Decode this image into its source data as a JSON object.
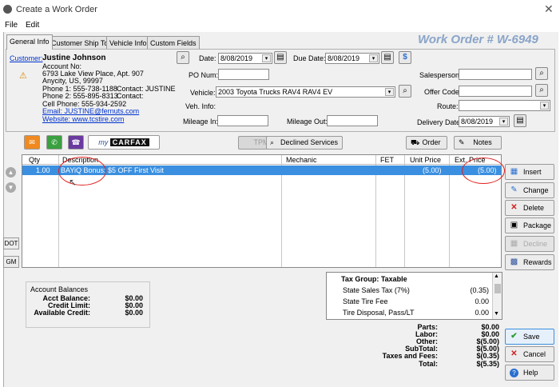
{
  "window": {
    "title": "Create a Work Order"
  },
  "menu": [
    "File",
    "Edit"
  ],
  "tabs": [
    "General Info",
    "Customer Ship To",
    "Vehicle Info",
    "Custom Fields"
  ],
  "work_order_title": "Work Order  # W-6949",
  "customer": {
    "label": "Customer:",
    "name": "Justine Johnson",
    "account": "Account No:",
    "address1": "6793 Lake View Place, Apt. 907",
    "address2": "Anycity, US, 99997",
    "phone1": "Phone 1: 555-738-1188",
    "contact1": "Contact: JUSTINE",
    "phone2": "Phone 2: 555-895-8313",
    "contact2": "Contact:",
    "cell": "Cell Phone: 555-934-2592",
    "email": "Email: JUSTINE@fernuts.com",
    "website": "Website: www.tcstire.com"
  },
  "fields": {
    "date_label": "Date:",
    "date": "8/08/2019",
    "due_label": "Due Date:",
    "due": "8/08/2019",
    "po_label": "PO Num:",
    "po": "",
    "vehicle_label": "Vehicle:",
    "vehicle": "2003 Toyota Trucks RAV4 RAV4 EV",
    "vehinfo_label": "Veh. Info:",
    "mileage_in_label": "Mileage In:",
    "mileage_in": "",
    "mileage_out_label": "Mileage Out:",
    "mileage_out": "",
    "salesperson_label": "Salesperson:",
    "salesperson": "",
    "offer_label": "Offer Code:",
    "offer": "",
    "route_label": "Route:",
    "route": "",
    "delivery_label": "Delivery Date:",
    "delivery": "8/08/2019"
  },
  "toolbar": {
    "carfax_my": "my",
    "carfax": "CARFAX",
    "tpms": "TPMS",
    "declined": "Declined Services",
    "order": "Order",
    "notes": "Notes"
  },
  "grid": {
    "columns": [
      "Qty",
      "Description",
      "Mechanic",
      "FET",
      "Unit Price",
      "Ext. Price"
    ],
    "rows": [
      {
        "qty": "1.00",
        "description": "BAYiQ Bonus: $5 OFF First Visit",
        "mechanic": "",
        "fet": "",
        "unit": "(5.00)",
        "ext": "(5.00)"
      }
    ]
  },
  "side_buttons": [
    "Insert",
    "Change",
    "Delete",
    "Package",
    "Decline",
    "Rewards",
    "Save",
    "Cancel",
    "Help"
  ],
  "left_buttons": [
    "DOT",
    "GM"
  ],
  "account_balances": {
    "title": "Account Balances",
    "rows": [
      {
        "label": "Acct Balance:",
        "value": "$0.00"
      },
      {
        "label": "Credit Limit:",
        "value": "$0.00"
      },
      {
        "label": "Available Credit:",
        "value": "$0.00"
      }
    ]
  },
  "tax": {
    "group": "Tax Group: Taxable",
    "rows": [
      {
        "label": "State Sales Tax (7%)",
        "value": "(0.35)"
      },
      {
        "label": "State Tire Fee",
        "value": "0.00"
      },
      {
        "label": "Tire Disposal, Pass/LT",
        "value": "0.00"
      }
    ]
  },
  "totals": [
    {
      "label": "Parts:",
      "value": "$0.00"
    },
    {
      "label": "Labor:",
      "value": "$0.00"
    },
    {
      "label": "Other:",
      "value": "$(5.00)"
    },
    {
      "label": "SubTotal:",
      "value": "$(5.00)"
    },
    {
      "label": "Taxes and Fees:",
      "value": "$(0.35)"
    },
    {
      "label": "Total:",
      "value": "$(5.35)"
    }
  ],
  "colors": {
    "accent": "#3a8fe0",
    "title": "#8aa4c8",
    "highlight": "#e02020"
  }
}
